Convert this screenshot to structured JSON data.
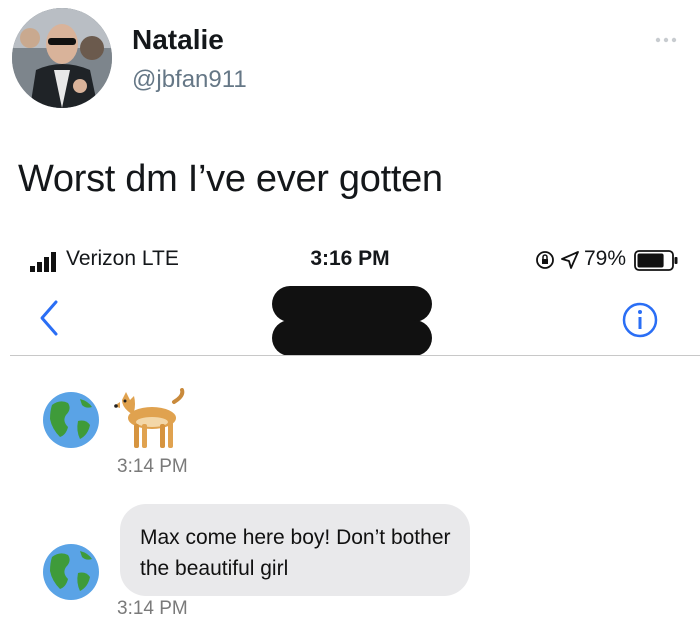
{
  "tweet": {
    "display_name": "Natalie",
    "handle": "@jbfan911",
    "text": "Worst dm I’ve ever gotten",
    "more_icon": "more-dots-icon"
  },
  "phone": {
    "carrier": "Verizon  LTE",
    "time": "3:16 PM",
    "battery_percent": "79%",
    "battery_level": 0.79,
    "messages": [
      {
        "type": "emoji",
        "content": "dog",
        "timestamp": "3:14 PM",
        "avatar": "globe-icon"
      },
      {
        "type": "text",
        "content": "Max come here boy! Don’t bother the beautiful girl",
        "timestamp": "3:14 PM",
        "avatar": "globe-icon"
      }
    ]
  },
  "colors": {
    "bubble": "#e9e9eb",
    "handle": "#657786",
    "redaction": "#111111"
  }
}
